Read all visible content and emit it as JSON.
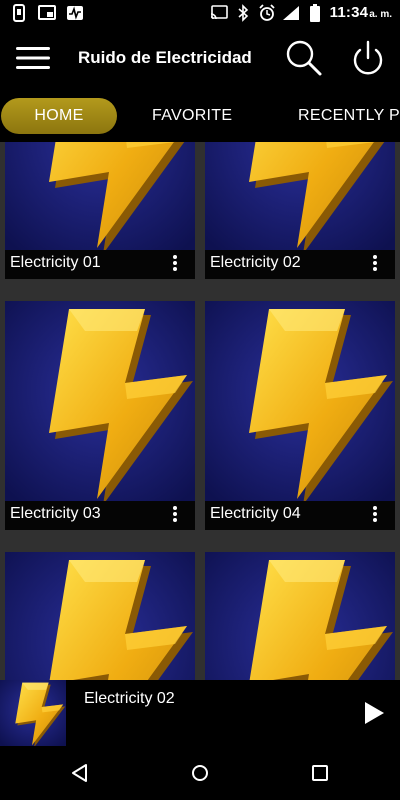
{
  "status_bar": {
    "time": "11:34",
    "ampm": "a. m.",
    "left_icons": [
      "phone-info-icon",
      "cast-notification-icon",
      "activity-icon"
    ],
    "right_icons": [
      "cast-icon",
      "bluetooth-icon",
      "alarm-icon",
      "signal-icon",
      "battery-icon"
    ]
  },
  "app_bar": {
    "title": "Ruido de Electricidad",
    "icons": [
      "menu-icon",
      "search-icon",
      "power-icon"
    ]
  },
  "tabs": [
    {
      "label": "HOME",
      "active": true
    },
    {
      "label": "FAVORITE",
      "active": false
    },
    {
      "label": "RECENTLY PL",
      "active": false
    }
  ],
  "grid": {
    "items": [
      {
        "title": "Electricity 01"
      },
      {
        "title": "Electricity 02"
      },
      {
        "title": "Electricity 03"
      },
      {
        "title": "Electricity 04"
      },
      {
        "title": ""
      },
      {
        "title": ""
      }
    ]
  },
  "now_playing": {
    "title": "Electricity 02"
  },
  "colors": {
    "accent_tab": "#a08a17",
    "art_bg": "#14176b",
    "bolt": "#f2b618"
  }
}
